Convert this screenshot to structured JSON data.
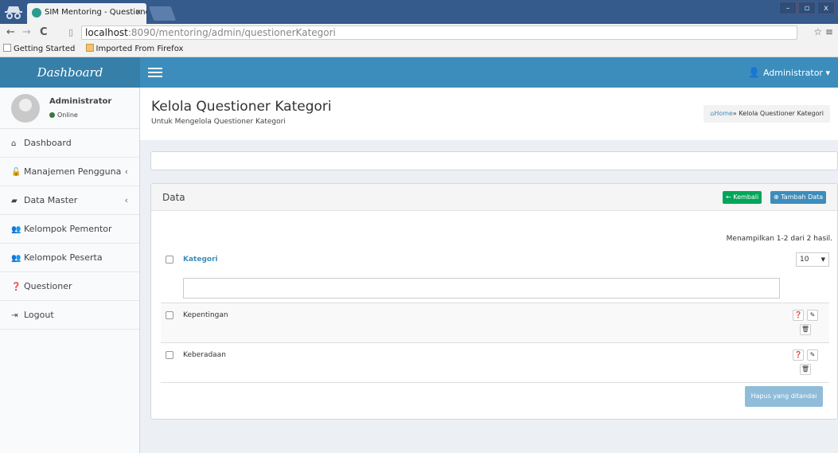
{
  "browser": {
    "tab_title": "SIM Mentoring - Questioner",
    "tab_close": "×",
    "url_host": "localhost",
    "url_rest": ":8090/mentoring/admin/questionerKategori",
    "window_controls": [
      "–",
      "▫",
      "x"
    ],
    "bookmarks": [
      "Getting Started",
      "Imported From Firefox"
    ]
  },
  "header": {
    "logo": "Dashboard",
    "user": "Administrator"
  },
  "sidebar": {
    "user_name": "Administrator",
    "user_status": "Online",
    "items": [
      {
        "label": "Dashboard",
        "icon": "home-icon",
        "glyph": "⌂",
        "has_chevron": false
      },
      {
        "label": "Manajemen Pengguna",
        "icon": "lock-icon",
        "glyph": "🔓",
        "has_chevron": true
      },
      {
        "label": "Data Master",
        "icon": "book-icon",
        "glyph": "▰",
        "has_chevron": true
      },
      {
        "label": "Kelompok Pementor",
        "icon": "users-icon",
        "glyph": "👥",
        "has_chevron": false
      },
      {
        "label": "Kelompok Peserta",
        "icon": "users-icon",
        "glyph": "👥",
        "has_chevron": false
      },
      {
        "label": "Questioner",
        "icon": "question-circle-icon",
        "glyph": "❓",
        "has_chevron": false
      },
      {
        "label": "Logout",
        "icon": "sign-out-icon",
        "glyph": "⇥",
        "has_chevron": false
      }
    ]
  },
  "page": {
    "title": "Kelola Questioner Kategori",
    "subtitle": "Untuk Mengelola Questioner Kategori",
    "breadcrumb_home": "Home",
    "breadcrumb_current": "» Kelola Questioner Kategori"
  },
  "box": {
    "title": "Data",
    "back_button": "← Kembali",
    "add_button": "⊕ Tambah Data",
    "summary": "Menampilkan 1-2 dari 2 hasil.",
    "column_header": "Kategori",
    "page_size": "10",
    "rows": [
      {
        "label": "Kepentingan"
      },
      {
        "label": "Keberadaan"
      }
    ],
    "delete_selected_button": "Hapus yang ditandai"
  },
  "colors": {
    "primary": "#3c8dbc",
    "success": "#00a65a",
    "sidebar_bg": "#f9fafc",
    "content_bg": "#ecf0f5"
  }
}
